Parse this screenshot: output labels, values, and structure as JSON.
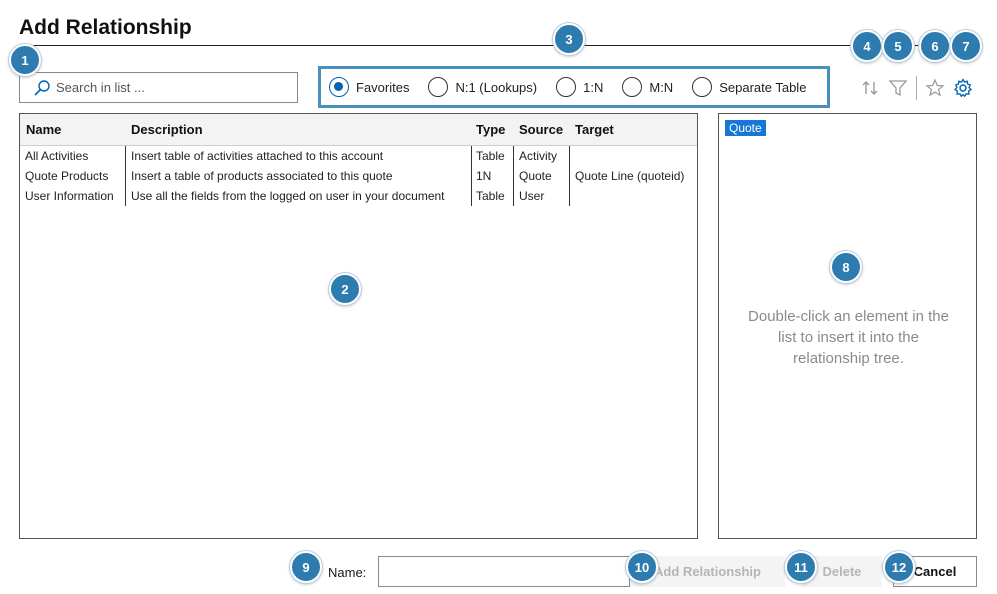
{
  "window": {
    "title": "Add Relationship"
  },
  "search": {
    "placeholder": "Search in list ..."
  },
  "radio_options": [
    {
      "label": "Favorites",
      "selected": true
    },
    {
      "label": "N:1 (Lookups)",
      "selected": false
    },
    {
      "label": "1:N",
      "selected": false
    },
    {
      "label": "M:N",
      "selected": false
    },
    {
      "label": "Separate Table",
      "selected": false
    }
  ],
  "toolbar": {
    "icons": [
      "sort-icon",
      "filter-icon",
      "star-icon",
      "gear-icon"
    ],
    "accent": "#0063b1"
  },
  "grid": {
    "columns": [
      "Name",
      "Description",
      "Type",
      "Source",
      "Target"
    ],
    "rows": [
      [
        "All Activities",
        "Insert table of activities attached to this account",
        "Table",
        "Activity",
        ""
      ],
      [
        "Quote Products",
        "Insert a table of products associated to this quote",
        "1N",
        "Quote",
        "Quote Line (quoteid)"
      ],
      [
        "User Information",
        "Use all the fields from the logged on user in your document",
        "Table",
        "User",
        ""
      ]
    ]
  },
  "tree": {
    "root_label": "Quote",
    "hint": "Double-click an element in the list to insert it into the relationship tree."
  },
  "footer": {
    "name_label": "Name:",
    "name_value": "",
    "add_label": "Add Relationship",
    "delete_label": "Delete",
    "cancel_label": "Cancel"
  },
  "badges": [
    "1",
    "2",
    "3",
    "4",
    "5",
    "6",
    "7",
    "8",
    "9",
    "10",
    "11",
    "12"
  ],
  "colors": {
    "badge": "#2e7bb0",
    "highlight_border": "#4a8fbd",
    "tag_bg": "#1478d4"
  }
}
